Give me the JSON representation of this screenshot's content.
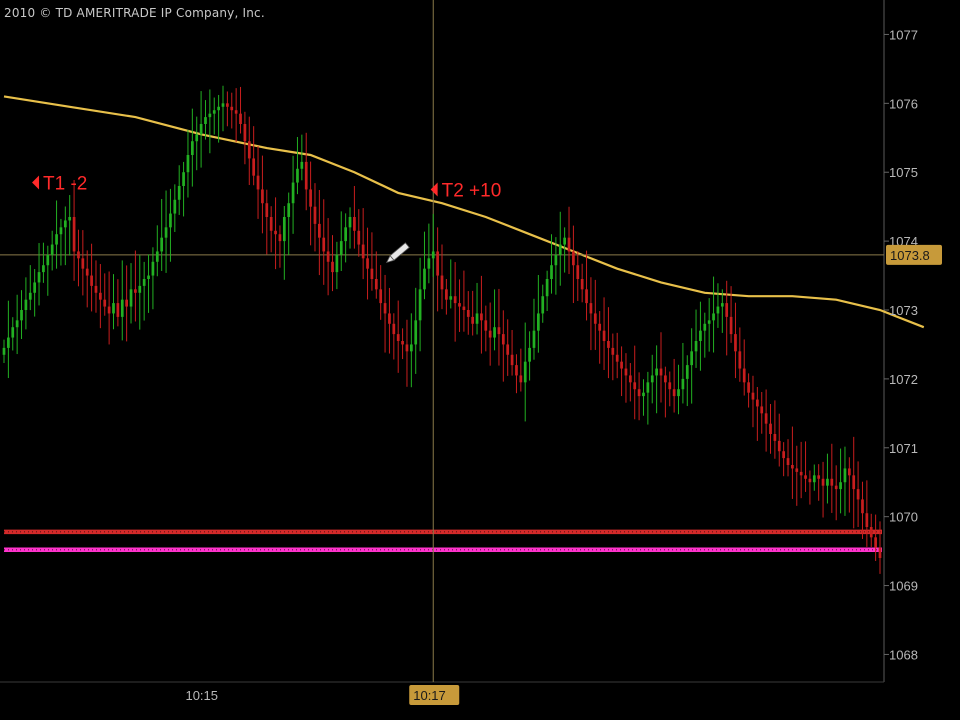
{
  "copyright": "2010 © TD AMERITRADE IP Company, Inc.",
  "colors": {
    "background": "#000000",
    "up": "#22b022",
    "down": "#c81e1e",
    "moving_average": "#e8c04a",
    "support_red": "#d42a2a",
    "support_magenta": "#ff33cc",
    "crosshair": "#8a7a4a",
    "axis_text": "#b8b8b8",
    "annotation": "#ff2a2a",
    "price_badge": "#c79a3a"
  },
  "chart_data": {
    "type": "candlestick",
    "title": "",
    "xlabel": "",
    "ylabel": "",
    "ylim": [
      1067.6,
      1077.5
    ],
    "y_ticks": [
      "1068",
      "1069",
      "1070",
      "1071",
      "1072",
      "1073",
      "1074",
      "1075",
      "1076",
      "1077"
    ],
    "x_ticks": [
      {
        "label": "10:15",
        "bar_index": 46
      },
      {
        "label": "10:17",
        "bar_index": 98,
        "highlighted": true
      }
    ],
    "current_price_label": "1073.8",
    "crosshair": {
      "bar_index": 98,
      "price": 1073.8
    },
    "horizontal_levels": [
      {
        "price": 1069.78,
        "color": "#d42a2a"
      },
      {
        "price": 1069.52,
        "color": "#ff33cc"
      }
    ],
    "annotations": [
      {
        "text": "T1 -2",
        "bar_index": 8,
        "price": 1074.85
      },
      {
        "text": "T2 +10",
        "bar_index": 99,
        "price": 1074.75
      }
    ],
    "closes": [
      1072.45,
      1072.6,
      1072.75,
      1072.85,
      1073.0,
      1073.15,
      1073.25,
      1073.4,
      1073.55,
      1073.65,
      1073.8,
      1073.95,
      1074.1,
      1074.2,
      1074.3,
      1074.35,
      1073.85,
      1073.75,
      1073.6,
      1073.5,
      1073.35,
      1073.25,
      1073.15,
      1073.05,
      1072.95,
      1073.1,
      1072.9,
      1073.15,
      1073.05,
      1073.3,
      1073.25,
      1073.35,
      1073.45,
      1073.5,
      1073.7,
      1073.85,
      1074.05,
      1074.2,
      1074.4,
      1074.6,
      1074.8,
      1075.0,
      1075.25,
      1075.45,
      1075.55,
      1075.7,
      1075.8,
      1075.85,
      1075.9,
      1075.95,
      1076.0,
      1075.95,
      1075.9,
      1075.85,
      1075.7,
      1075.45,
      1075.2,
      1074.95,
      1074.75,
      1074.55,
      1074.35,
      1074.15,
      1074.1,
      1074.0,
      1074.35,
      1074.55,
      1074.85,
      1075.05,
      1075.15,
      1074.75,
      1074.5,
      1074.25,
      1074.05,
      1073.85,
      1073.7,
      1073.55,
      1073.8,
      1074.0,
      1074.2,
      1074.35,
      1074.15,
      1073.95,
      1073.75,
      1073.6,
      1073.45,
      1073.3,
      1073.1,
      1072.95,
      1072.8,
      1072.65,
      1072.55,
      1072.5,
      1072.4,
      1072.5,
      1072.85,
      1073.3,
      1073.6,
      1073.75,
      1073.85,
      1073.5,
      1073.3,
      1073.15,
      1073.2,
      1073.1,
      1073.05,
      1073.0,
      1072.9,
      1072.8,
      1072.95,
      1072.85,
      1072.7,
      1072.6,
      1072.75,
      1072.65,
      1072.5,
      1072.35,
      1072.2,
      1072.05,
      1071.95,
      1072.25,
      1072.45,
      1072.7,
      1072.95,
      1073.2,
      1073.45,
      1073.65,
      1073.8,
      1073.95,
      1074.05,
      1073.85,
      1073.65,
      1073.45,
      1073.3,
      1073.1,
      1072.95,
      1072.8,
      1072.7,
      1072.55,
      1072.45,
      1072.35,
      1072.25,
      1072.15,
      1072.05,
      1071.95,
      1071.85,
      1071.75,
      1071.8,
      1071.95,
      1072.05,
      1072.15,
      1072.05,
      1071.95,
      1071.85,
      1071.75,
      1071.85,
      1072.0,
      1072.2,
      1072.4,
      1072.55,
      1072.7,
      1072.8,
      1072.85,
      1072.95,
      1073.05,
      1073.1,
      1072.9,
      1072.65,
      1072.4,
      1072.15,
      1071.95,
      1071.8,
      1071.7,
      1071.6,
      1071.5,
      1071.35,
      1071.2,
      1071.1,
      1070.95,
      1070.85,
      1070.75,
      1070.7,
      1070.65,
      1070.6,
      1070.55,
      1070.5,
      1070.6,
      1070.55,
      1070.45,
      1070.55,
      1070.45,
      1070.4,
      1070.5,
      1070.7,
      1070.6,
      1070.4,
      1070.25,
      1070.05,
      1069.85,
      1069.7,
      1069.55,
      1069.4
    ],
    "moving_average": [
      [
        0,
        1076.1
      ],
      [
        15,
        1075.95
      ],
      [
        30,
        1075.8
      ],
      [
        45,
        1075.55
      ],
      [
        60,
        1075.35
      ],
      [
        70,
        1075.25
      ],
      [
        80,
        1075.0
      ],
      [
        90,
        1074.7
      ],
      [
        100,
        1074.55
      ],
      [
        110,
        1074.35
      ],
      [
        120,
        1074.1
      ],
      [
        130,
        1073.85
      ],
      [
        140,
        1073.6
      ],
      [
        150,
        1073.4
      ],
      [
        160,
        1073.25
      ],
      [
        170,
        1073.2
      ],
      [
        180,
        1073.2
      ],
      [
        190,
        1073.15
      ],
      [
        200,
        1073.0
      ],
      [
        210,
        1072.75
      ]
    ]
  }
}
